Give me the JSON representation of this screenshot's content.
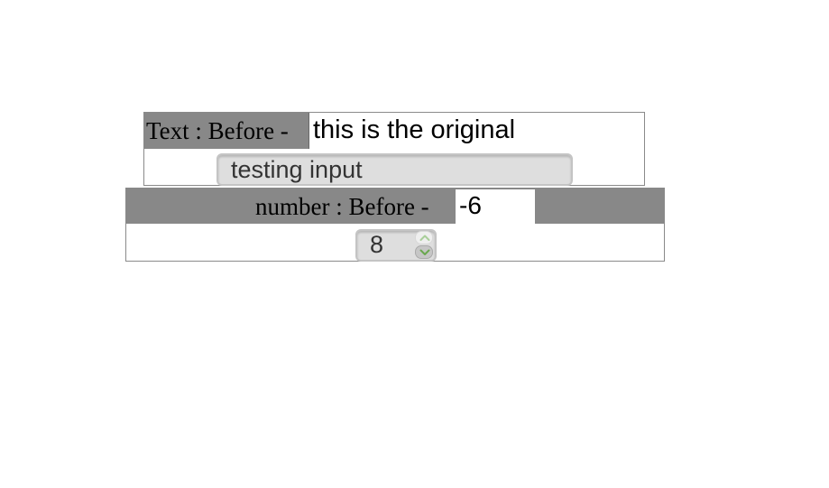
{
  "text_section": {
    "before_label": "Text : Before -",
    "before_value": "this is the original",
    "test_input_value": "testing input"
  },
  "number_section": {
    "before_label": "number : Before -",
    "before_value": "-6",
    "test_input_value": "8"
  },
  "icons": {
    "spin_up": "chevron-up-icon",
    "spin_down": "chevron-down-icon"
  },
  "colors": {
    "label_background": "#888888",
    "input_background": "#dedede",
    "spinner_arrow": "#6aa84f"
  }
}
